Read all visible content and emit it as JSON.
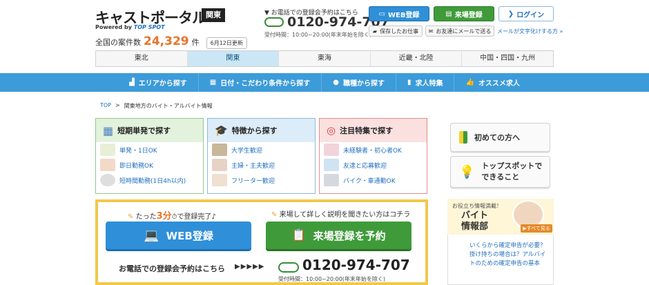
{
  "header": {
    "logo_text": "キャストポータル",
    "powered_by": "Powered by",
    "powered_brand": "TOP SPOT",
    "region_badge": "関東",
    "count_label": "全国の案件数",
    "count_value": "24,329",
    "count_unit": "件",
    "update_badge": "6月12日更新",
    "phone_label": "▼ お電話での登録会予約はこちら",
    "phone_number": "0120-974-707",
    "phone_hours": "受付時間：10:00~20:00(年末年始を除く)",
    "buttons": {
      "web_register": "WEB登録",
      "venue_register": "来場登録",
      "login": "ログイン",
      "saved_jobs": "保存したお仕事",
      "mail_friend": "お友達にメールで送る",
      "mail_link": "メールが文字化けする方 »"
    }
  },
  "region_tabs": [
    "東北",
    "関東",
    "東海",
    "近畿・北陸",
    "中国・四国・九州"
  ],
  "active_region": 1,
  "main_nav": [
    "エリアから探す",
    "日付・こだわり条件から探す",
    "職種から探す",
    "求人特集",
    "オススメ求人"
  ],
  "breadcrumb": {
    "home": "TOP",
    "separator": ">",
    "current": "関東地方のバイト・アルバイト情報"
  },
  "panels": [
    {
      "title": "短期単発で探す",
      "items": [
        "単発・1日OK",
        "即日勤務OK",
        "短時間勤務(1日4h以内)"
      ]
    },
    {
      "title": "特徴から探す",
      "items": [
        "大学生歓迎",
        "主婦・主夫歓迎",
        "フリーター歓迎"
      ]
    },
    {
      "title": "注目特集で探す",
      "items": [
        "未経験者・初心者OK",
        "友達と応募歓迎",
        "バイク・車通勤OK"
      ]
    }
  ],
  "signup": {
    "catch_prefix": "たった",
    "catch_highlight": "3分",
    "catch_suffix": "で登録完了♪",
    "catch_right": "来場して詳しく説明を聞きたい方はコチラ",
    "web_button": "WEB登録",
    "venue_button": "来場登録を予約",
    "call_text": "お電話での登録会予約はこちら",
    "arrows": "▶▶▶▶▶",
    "phone_number": "0120-974-707",
    "phone_hours": "受付時間：10:00~20:00(年末年始を除く)"
  },
  "sidebar": {
    "first_time": "初めての方へ",
    "about_line1": "トップスポットで",
    "about_line2": "できること",
    "banner_small": "お役立ち情報満載！",
    "banner_title_1": "バイト",
    "banner_title_2": "情報部",
    "see_all": "▶すべて見る",
    "banner_text": "いくらから確定申告が必要？掛け持ちの場合は？アルバイトのための確定申告の基本"
  },
  "colors": {
    "nav_blue": "#3c9bd9",
    "accent_orange": "#e8742a",
    "web_blue": "#2f8fd8",
    "venue_green": "#3f9b3a",
    "signup_border": "#f2c84b"
  }
}
